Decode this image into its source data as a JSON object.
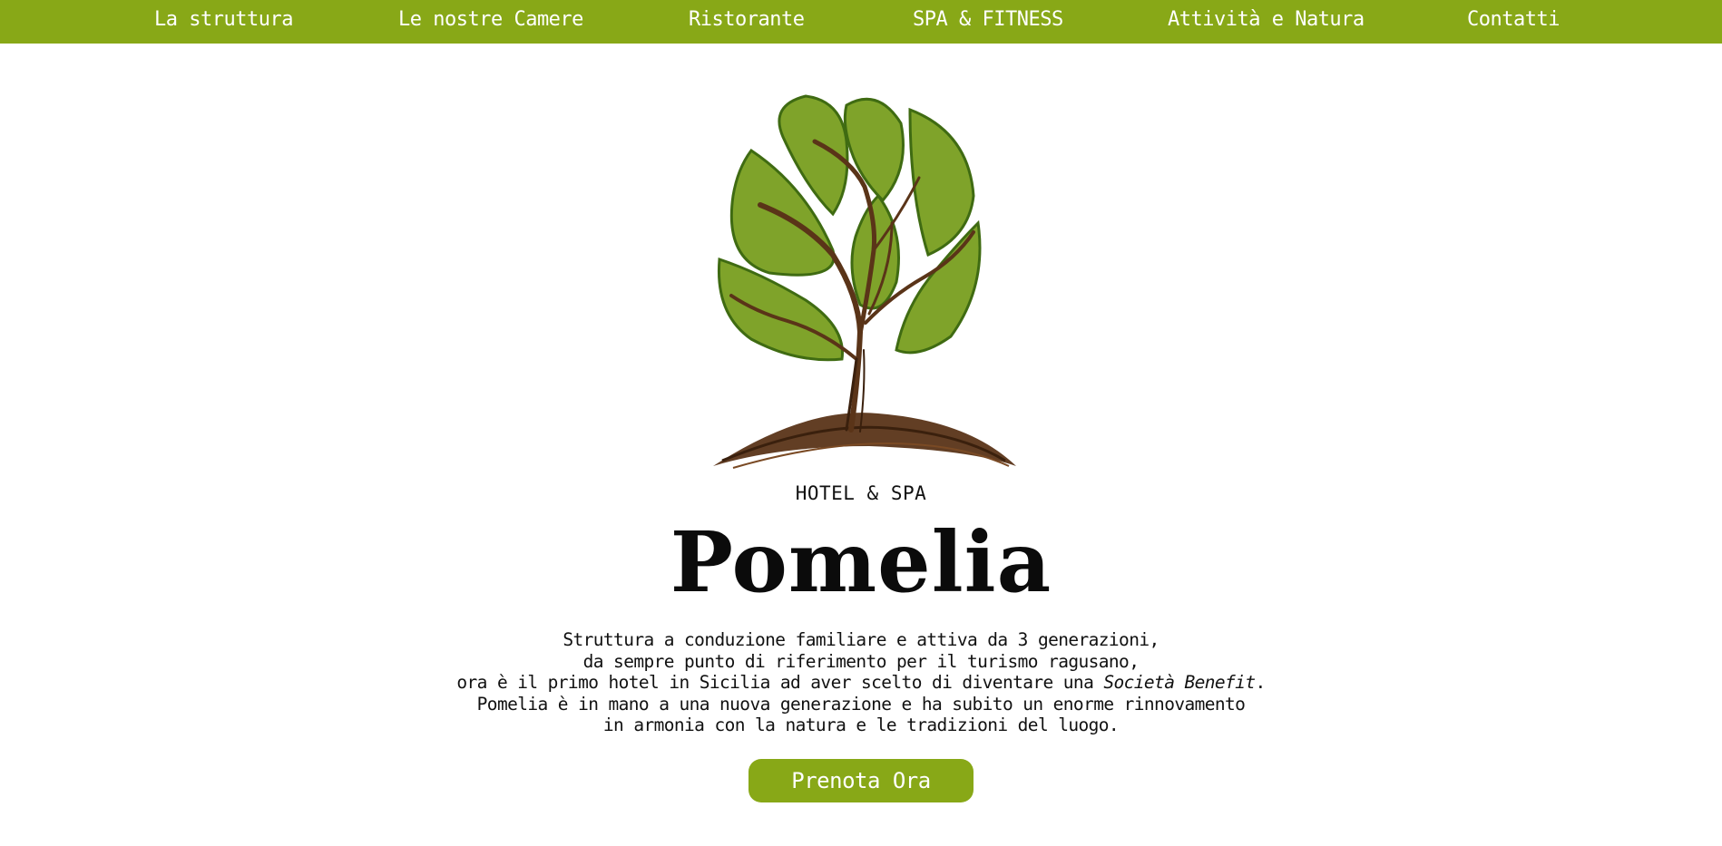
{
  "nav": {
    "items": [
      {
        "label": "La struttura"
      },
      {
        "label": "Le nostre Camere"
      },
      {
        "label": "Ristorante"
      },
      {
        "label": "SPA & FITNESS"
      },
      {
        "label": "Attività e Natura"
      },
      {
        "label": "Contatti"
      }
    ]
  },
  "brand": {
    "subtitle": "HOTEL & SPA",
    "name": "Pomelia",
    "logo_icon": "tree-logo-icon"
  },
  "intro": {
    "line1": "Struttura a conduzione familiare e attiva da 3 generazioni,",
    "line2": "da sempre punto di riferimento per il turismo ragusano,",
    "line3_prefix": "ora è il primo hotel in Sicilia ad aver scelto di diventare una ",
    "line3_emphasis": "Società Benefit",
    "line3_suffix": ".",
    "line4": "Pomelia è in mano a una nuova generazione e ha subito un enorme rinnovamento",
    "line5": "in armonia con la natura e le tradizioni del luogo."
  },
  "cta": {
    "label": "Prenota Ora"
  },
  "colors": {
    "accent": "#88a817",
    "leaf": "#7fa32a",
    "leaf_dark": "#3f6b12",
    "trunk": "#5a3418",
    "text": "#111111",
    "background": "#ffffff"
  }
}
